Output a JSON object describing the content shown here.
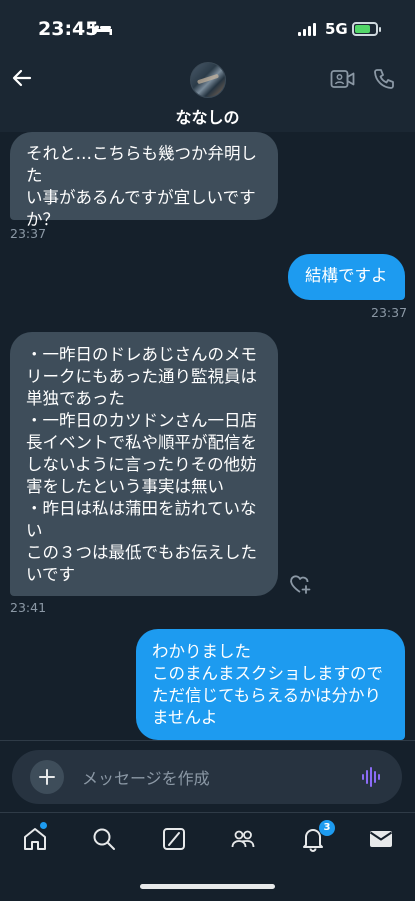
{
  "status_bar": {
    "time": "23:45",
    "network": "5G"
  },
  "header": {
    "contact_name": "ななしの"
  },
  "messages": [
    {
      "side": "received",
      "text": "それと…こちらも幾つか弁明した\nい事があるんですが宜しいです\nか？",
      "time": "23:37"
    },
    {
      "side": "sent",
      "text": "結構ですよ",
      "time": "23:37"
    },
    {
      "side": "received",
      "text": "・一昨日のドレあじさんのメモ\nリークにもあった通り監視員は\n単独であった\n・一昨日のカツドンさん一日店\n長イベントで私や順平が配信を\nしないように言ったりその他妨\n害をしたという事実は無い\n・昨日は私は蒲田を訪れていな\nい\nこの３つは最低でもお伝えした\nいです",
      "time": "23:41"
    },
    {
      "side": "sent",
      "text": "わかりました\nこのまんまスクショしますので\nただ信じてもらえるかは分かり\nませんよ"
    }
  ],
  "composer": {
    "placeholder": "メッセージを作成"
  },
  "tabbar": {
    "notifications_badge": "3"
  },
  "colors": {
    "accent": "#1d9bf0",
    "background": "#15202b",
    "received_bubble": "#3e4d5a"
  }
}
